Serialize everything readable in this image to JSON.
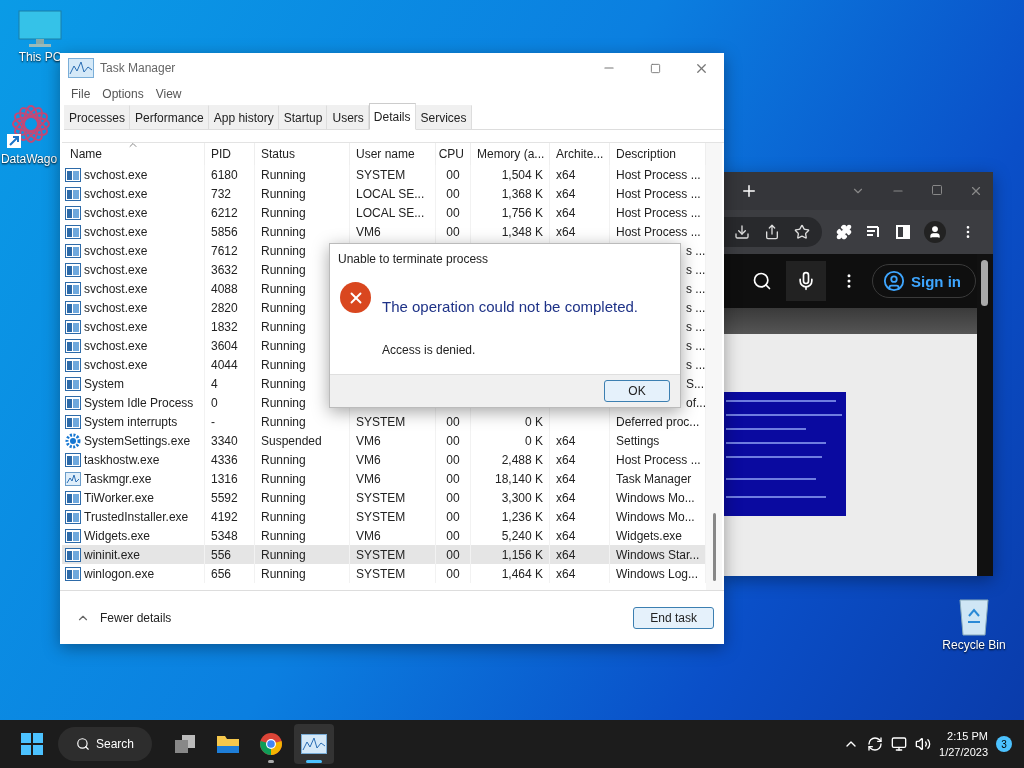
{
  "desktop_icons": [
    {
      "label": "This PC",
      "kind": "pc"
    },
    {
      "label": "DataWago",
      "kind": "shortcut"
    },
    {
      "label": "Recycle Bin",
      "kind": "bin"
    }
  ],
  "browser": {
    "sign_in": "Sign in"
  },
  "task_manager": {
    "title": "Task Manager",
    "menu": [
      "File",
      "Options",
      "View"
    ],
    "tabs": [
      {
        "label": "Processes",
        "selected": false
      },
      {
        "label": "Performance",
        "selected": false
      },
      {
        "label": "App history",
        "selected": false
      },
      {
        "label": "Startup",
        "selected": false
      },
      {
        "label": "Users",
        "selected": false
      },
      {
        "label": "Details",
        "selected": true
      },
      {
        "label": "Services",
        "selected": false
      }
    ],
    "columns": [
      "Name",
      "PID",
      "Status",
      "User name",
      "CPU",
      "Memory (a...",
      "Archite...",
      "Description"
    ],
    "rows": [
      {
        "kind": "app",
        "name": "svchost.exe",
        "pid": "6180",
        "status": "Running",
        "user": "SYSTEM",
        "cpu": "00",
        "memory": "1,504 K",
        "arch": "x64",
        "description": "Host Process ...",
        "selected": false
      },
      {
        "kind": "app",
        "name": "svchost.exe",
        "pid": "732",
        "status": "Running",
        "user": "LOCAL SE...",
        "cpu": "00",
        "memory": "1,368 K",
        "arch": "x64",
        "description": "Host Process ...",
        "selected": false
      },
      {
        "kind": "app",
        "name": "svchost.exe",
        "pid": "6212",
        "status": "Running",
        "user": "LOCAL SE...",
        "cpu": "00",
        "memory": "1,756 K",
        "arch": "x64",
        "description": "Host Process ...",
        "selected": false
      },
      {
        "kind": "app",
        "name": "svchost.exe",
        "pid": "5856",
        "status": "Running",
        "user": "VM6",
        "cpu": "00",
        "memory": "1,348 K",
        "arch": "x64",
        "description": "Host Process ...",
        "selected": false
      },
      {
        "kind": "app",
        "name": "svchost.exe",
        "pid": "7612",
        "status": "Running",
        "description": "s ...",
        "selected": false
      },
      {
        "kind": "app",
        "name": "svchost.exe",
        "pid": "3632",
        "status": "Running",
        "description": "s ...",
        "selected": false
      },
      {
        "kind": "app",
        "name": "svchost.exe",
        "pid": "4088",
        "status": "Running",
        "description": "s ...",
        "selected": false
      },
      {
        "kind": "app",
        "name": "svchost.exe",
        "pid": "2820",
        "status": "Running",
        "description": "s ...",
        "selected": false
      },
      {
        "kind": "app",
        "name": "svchost.exe",
        "pid": "1832",
        "status": "Running",
        "description": "s ...",
        "selected": false
      },
      {
        "kind": "app",
        "name": "svchost.exe",
        "pid": "3604",
        "status": "Running",
        "description": "s ...",
        "selected": false
      },
      {
        "kind": "app",
        "name": "svchost.exe",
        "pid": "4044",
        "status": "Running",
        "description": "s ...",
        "selected": false
      },
      {
        "kind": "app",
        "name": "System",
        "pid": "4",
        "status": "Running",
        "description": "S...",
        "selected": false
      },
      {
        "kind": "app",
        "name": "System Idle Process",
        "pid": "0",
        "status": "Running",
        "description": "of...",
        "selected": false
      },
      {
        "kind": "app",
        "name": "System interrupts",
        "pid": "-",
        "status": "Running",
        "user": "SYSTEM",
        "cpu": "00",
        "memory": "0 K",
        "description": "Deferred proc...",
        "selected": false
      },
      {
        "kind": "gear",
        "name": "SystemSettings.exe",
        "pid": "3340",
        "status": "Suspended",
        "user": "VM6",
        "cpu": "00",
        "memory": "0 K",
        "arch": "x64",
        "description": "Settings",
        "selected": false
      },
      {
        "kind": "app",
        "name": "taskhostw.exe",
        "pid": "4336",
        "status": "Running",
        "user": "VM6",
        "cpu": "00",
        "memory": "2,488 K",
        "arch": "x64",
        "description": "Host Process ...",
        "selected": false
      },
      {
        "kind": "chart",
        "name": "Taskmgr.exe",
        "pid": "1316",
        "status": "Running",
        "user": "VM6",
        "cpu": "00",
        "memory": "18,140 K",
        "arch": "x64",
        "description": "Task Manager",
        "selected": false
      },
      {
        "kind": "app",
        "name": "TiWorker.exe",
        "pid": "5592",
        "status": "Running",
        "user": "SYSTEM",
        "cpu": "00",
        "memory": "3,300 K",
        "arch": "x64",
        "description": "Windows Mo...",
        "selected": false
      },
      {
        "kind": "app",
        "name": "TrustedInstaller.exe",
        "pid": "4192",
        "status": "Running",
        "user": "SYSTEM",
        "cpu": "00",
        "memory": "1,236 K",
        "arch": "x64",
        "description": "Windows Mo...",
        "selected": false
      },
      {
        "kind": "app",
        "name": "Widgets.exe",
        "pid": "5348",
        "status": "Running",
        "user": "VM6",
        "cpu": "00",
        "memory": "5,240 K",
        "arch": "x64",
        "description": "Widgets.exe",
        "selected": false
      },
      {
        "kind": "app",
        "name": "wininit.exe",
        "pid": "556",
        "status": "Running",
        "user": "SYSTEM",
        "cpu": "00",
        "memory": "1,156 K",
        "arch": "x64",
        "description": "Windows Star...",
        "selected": true
      },
      {
        "kind": "app",
        "name": "winlogon.exe",
        "pid": "656",
        "status": "Running",
        "user": "SYSTEM",
        "cpu": "00",
        "memory": "1,464 K",
        "arch": "x64",
        "description": "Windows Log...",
        "selected": false
      }
    ],
    "fewer_details": "Fewer details",
    "end_task": "End task"
  },
  "dialog": {
    "title": "Unable to terminate process",
    "heading": "The operation could not be completed.",
    "message": "Access is denied.",
    "button": "OK"
  },
  "taskbar": {
    "search": "Search",
    "apps": [
      {
        "kind": "taskview",
        "running": false,
        "selected": false
      },
      {
        "kind": "explorer",
        "running": false,
        "selected": false
      },
      {
        "kind": "chrome",
        "running": true,
        "selected": false
      },
      {
        "kind": "taskmgr",
        "running": true,
        "selected": true
      }
    ],
    "time": "2:15 PM",
    "date": "1/27/2023",
    "notifications": "3"
  }
}
